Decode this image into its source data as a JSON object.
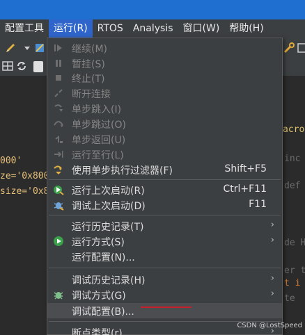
{
  "menubar": {
    "items": [
      "配置工具",
      "运行(R)",
      "RTOS",
      "Analysis",
      "窗口(W)",
      "帮助(H)"
    ]
  },
  "editor": {
    "left_lines": [
      "000'",
      "ze='0x800",
      "size='0x8"
    ],
    "right_lines": [
      "acro",
      "inc",
      "def",
      "de H",
      "er t",
      "t i",
      "te"
    ]
  },
  "run_menu": {
    "items": [
      {
        "label": "继续(M)",
        "disabled": true
      },
      {
        "label": "暂挂(S)",
        "disabled": true
      },
      {
        "label": "终止(T)",
        "disabled": true
      },
      {
        "label": "断开连接",
        "disabled": true
      },
      {
        "label": "单步跳入(I)",
        "disabled": true
      },
      {
        "label": "单步跳过(O)",
        "disabled": true
      },
      {
        "label": "单步返回(U)",
        "disabled": true
      },
      {
        "label": "运行至行(L)",
        "disabled": true
      },
      {
        "label": "使用单步执行过滤器(F)",
        "shortcut": "Shift+F5"
      },
      {
        "label": "运行上次启动(R)",
        "shortcut": "Ctrl+F11"
      },
      {
        "label": "调试上次启动(D)",
        "shortcut": "F11"
      },
      {
        "label": "运行历史记录(T)",
        "submenu": true
      },
      {
        "label": "运行方式(S)",
        "submenu": true
      },
      {
        "label": "运行配置(N)..."
      },
      {
        "label": "调试历史记录(H)",
        "submenu": true
      },
      {
        "label": "调试方式(G)",
        "submenu": true
      },
      {
        "label": "调试配置(B)...",
        "highlighted": true
      },
      {
        "label": "断点类型(r)",
        "submenu": true
      }
    ],
    "submenu_glyph": "›"
  },
  "watermark": "CSDN @LostSpeed",
  "colors": {
    "menubar_active": "#2f65ca",
    "menu_bg": "#3c3f41",
    "menu_highlight": "#4b4d50",
    "annotation_underline": "#c8202a"
  }
}
